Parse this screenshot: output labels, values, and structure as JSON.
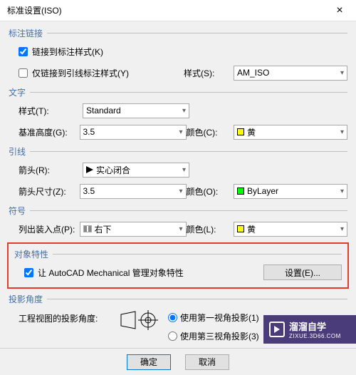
{
  "window": {
    "title": "标准设置(ISO)",
    "close": "×"
  },
  "sections": {
    "link": {
      "title": "标注链接",
      "chk1_label": "链接到标注样式(K)",
      "chk1_checked": true,
      "chk2_label": "仅链接到引线标注样式(Y)",
      "chk2_checked": false,
      "style_label": "样式(S):",
      "style_value": "AM_ISO"
    },
    "text": {
      "title": "文字",
      "style_label": "样式(T):",
      "style_value": "Standard",
      "height_label": "基准高度(G):",
      "height_value": "3.5",
      "color_label": "颜色(C):",
      "color_value": "黄"
    },
    "leader": {
      "title": "引线",
      "arrow_label": "箭头(R):",
      "arrow_value": "实心闭合",
      "size_label": "箭头尺寸(Z):",
      "size_value": "3.5",
      "color_label": "颜色(O):",
      "color_value": "ByLayer"
    },
    "symbol": {
      "title": "符号",
      "insert_label": "列出装入点(P):",
      "insert_value": "右下",
      "color_label": "颜色(L):",
      "color_value": "黄"
    },
    "objprops": {
      "title": "对象特性",
      "chk_label": "让 AutoCAD Mechanical 管理对象特性",
      "chk_checked": true,
      "btn_label": "设置(E)..."
    },
    "projection": {
      "title": "投影角度",
      "label": "工程视图的投影角度:",
      "opt1": "使用第一视角投影(1)",
      "opt2": "使用第三视角投影(3)",
      "selected": 0
    }
  },
  "footer": {
    "ok": "确定",
    "cancel": "取消"
  },
  "watermark": {
    "line1": "溜溜自学",
    "line2": "ZIXUE.3D66.COM"
  }
}
